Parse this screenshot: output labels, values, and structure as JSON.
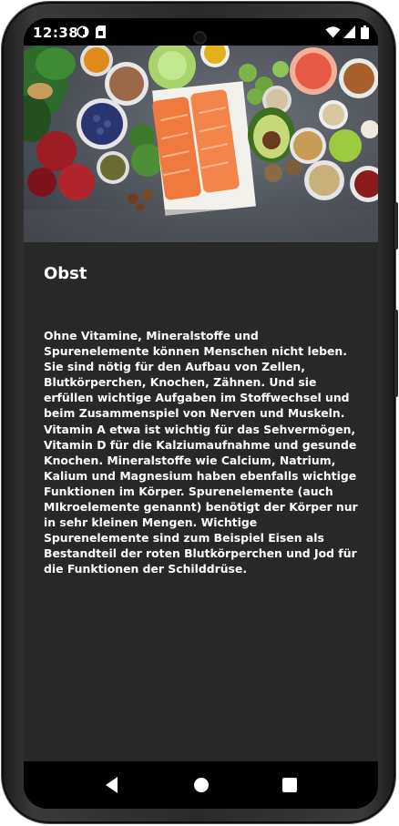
{
  "status_bar": {
    "time": "12:38",
    "icons": [
      "app-notification-icon",
      "sim-card-icon",
      "wifi-icon",
      "cellular-signal-icon",
      "battery-icon"
    ]
  },
  "hero_image": {
    "subject": "healthy-food-flatlay"
  },
  "article": {
    "title": "Obst",
    "body": "Ohne Vitamine, Mineralstoffe und Spurenelemente können Menschen nicht leben. Sie sind nötig für den Aufbau von Zellen, Blutkörperchen, Knochen, Zähnen. Und sie erfüllen wichtige Aufgaben im Stoffwechsel und beim Zusammenspiel von Nerven und Muskeln. Vitamin A etwa ist wichtig für das Sehvermögen, Vitamin D für die Kalziumaufnahme und gesunde Knochen. Mineralstoffe wie Calcium, Natrium, Kalium und Magnesium haben ebenfalls wichtige Funktionen im Körper. Spurenelemente (auch MIkroelemente genannt) benötigt der Körper nur in sehr kleinen Mengen. Wichtige Spurenelemente sind zum Beispiel Eisen als Bestandteil der roten Blutkörperchen und Jod für die Funktionen der Schilddrüse."
  },
  "nav_bar": {
    "buttons": [
      "back-icon",
      "home-icon",
      "recents-icon"
    ]
  },
  "colors": {
    "content_background": "#282828",
    "text": "#ffffff",
    "nav_background": "#000000"
  }
}
